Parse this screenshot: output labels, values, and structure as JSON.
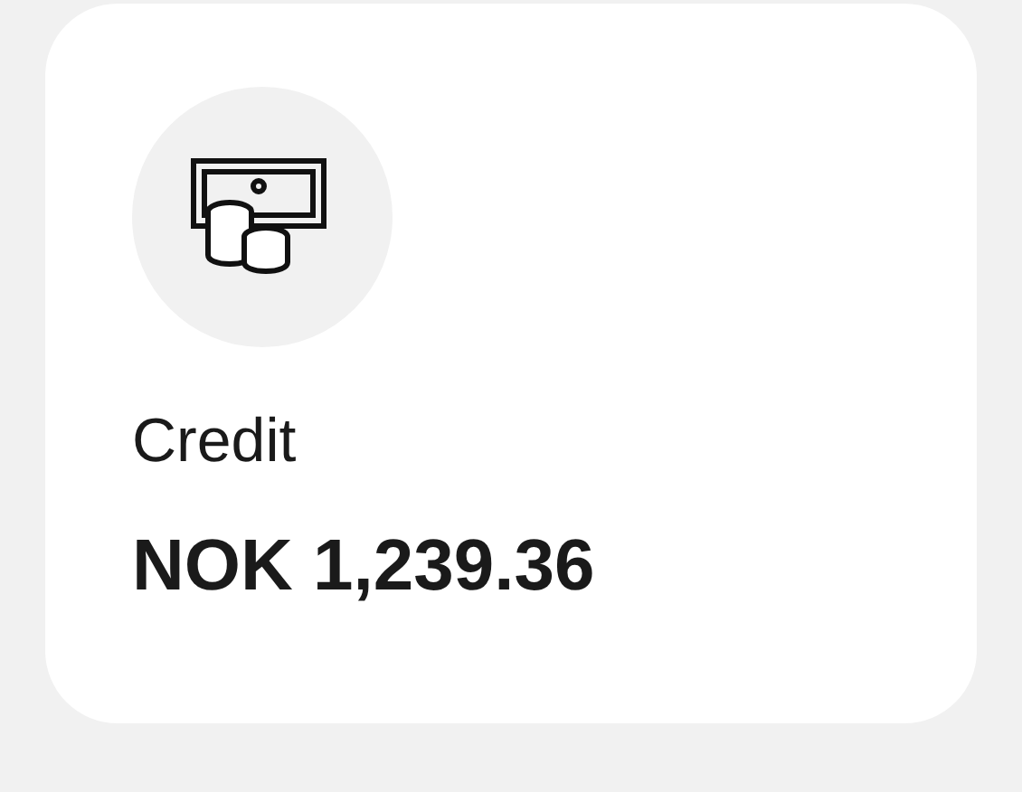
{
  "card": {
    "label": "Credit",
    "amount": "NOK 1,239.36"
  }
}
